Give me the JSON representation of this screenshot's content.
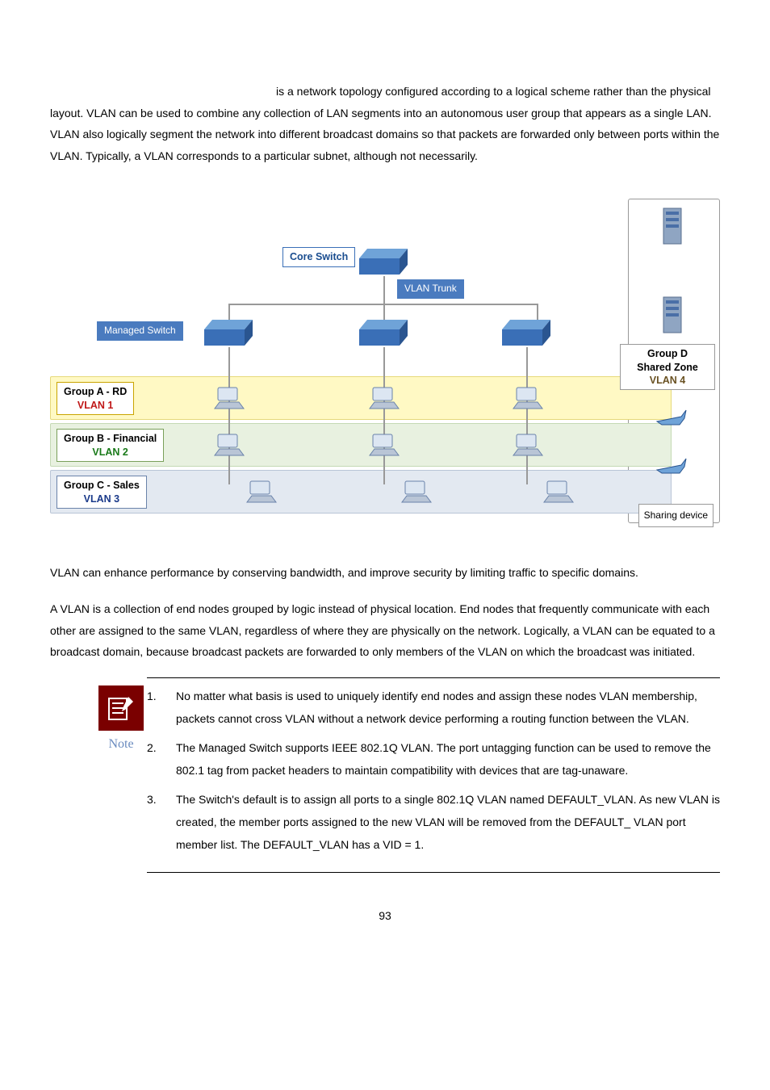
{
  "intro": {
    "lead_spacer": "",
    "text_part1": "is a network topology configured according to a logical scheme rather than the physical layout. VLAN can be used to combine any collection of LAN segments into an autonomous user group that appears as a single LAN. VLAN also logically segment the network into different broadcast domains so that packets are forwarded only between ports within the VLAN. Typically, a VLAN corresponds to a particular subnet, although not necessarily."
  },
  "diagram": {
    "core_switch": "Core Switch",
    "vlan_trunk": "VLAN Trunk",
    "managed_switch": "Managed Switch",
    "group_a_title": "Group A - RD",
    "group_a_vlan": "VLAN 1",
    "group_b_title": "Group B - Financial",
    "group_b_vlan": "VLAN 2",
    "group_c_title": "Group C - Sales",
    "group_c_vlan": "VLAN 3",
    "group_d_title": "Group D",
    "group_d_sub": "Shared Zone",
    "group_d_vlan": "VLAN 4",
    "sharing_device": "Sharing device"
  },
  "after": {
    "p1": "VLAN can enhance performance by conserving bandwidth, and improve security by limiting traffic to specific domains.",
    "p2": "A VLAN is a collection of end nodes grouped by logic instead of physical location. End nodes that frequently communicate with each other are assigned to the same VLAN, regardless of where they are physically on the network. Logically, a VLAN can be equated to a broadcast domain, because broadcast packets are forwarded to only members of the VLAN on which the broadcast was initiated."
  },
  "note": {
    "label": "Note",
    "items": [
      {
        "num": "1.",
        "text": "No matter what basis is used to uniquely identify end nodes and assign these nodes VLAN membership, packets cannot cross VLAN without a network device performing a routing function between the VLAN."
      },
      {
        "num": "2.",
        "text": "The Managed Switch supports IEEE 802.1Q VLAN. The port untagging function can be used to remove the 802.1 tag from packet headers to maintain compatibility with devices that are tag-unaware."
      },
      {
        "num": "3.",
        "text": "The Switch's default is to assign all ports to a single 802.1Q VLAN named DEFAULT_VLAN. As new VLAN is created, the member ports assigned to the new VLAN will be removed from the DEFAULT_ VLAN port member list. The DEFAULT_VLAN has a VID = 1."
      }
    ]
  },
  "page_number": "93"
}
